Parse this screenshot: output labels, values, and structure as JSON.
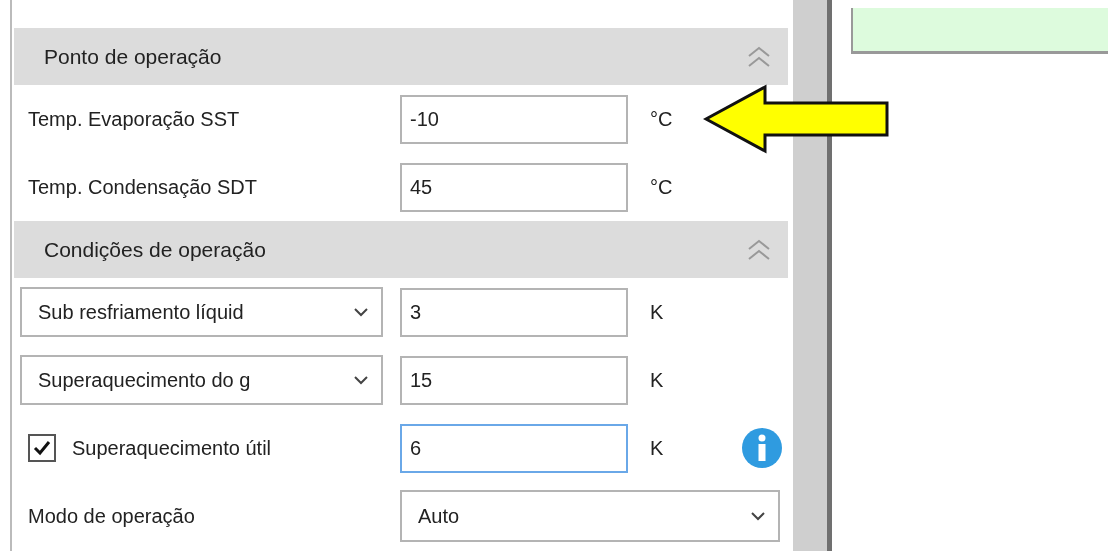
{
  "sections": [
    {
      "title": "Ponto de operação",
      "expanded": true,
      "rows": [
        {
          "kind": "field",
          "label": "Temp. Evaporação SST",
          "value": "-10",
          "unit": "°C",
          "focused": false
        },
        {
          "kind": "field",
          "label": "Temp. Condensação SDT",
          "value": "45",
          "unit": "°C",
          "focused": false
        }
      ]
    },
    {
      "title": "Condições de operação",
      "expanded": true,
      "rows": [
        {
          "kind": "select-field",
          "choice": "Sub resfriamento líquid",
          "value": "3",
          "unit": "K",
          "focused": false
        },
        {
          "kind": "select-field",
          "choice": "Superaquecimento do g",
          "value": "15",
          "unit": "K",
          "focused": false
        },
        {
          "kind": "checkbox-field",
          "label": "Superaquecimento útil",
          "checked": true,
          "value": "6",
          "unit": "K",
          "focused": true,
          "info": true
        },
        {
          "kind": "dropdown",
          "label": "Modo de operação",
          "value": "Auto"
        }
      ]
    }
  ],
  "annotation": {
    "kind": "arrow"
  }
}
